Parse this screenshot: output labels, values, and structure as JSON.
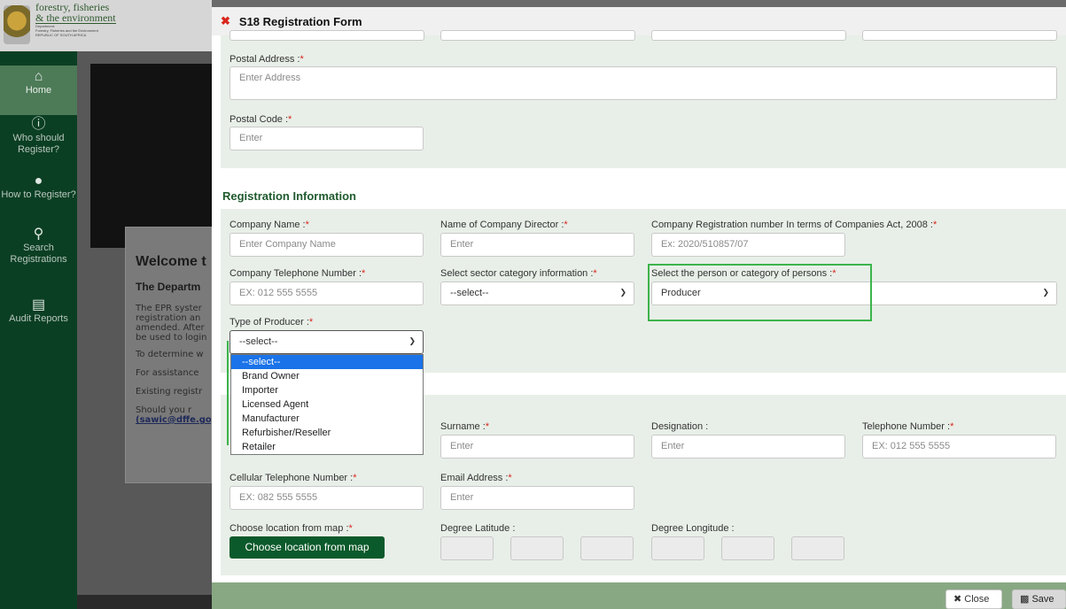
{
  "site": {
    "logo_line1": "forestry, fisheries",
    "logo_line2": "& the environment",
    "logo_small1": "Department:",
    "logo_small2": "Forestry, Fisheries and the Environment",
    "logo_small3": "REPUBLIC OF SOUTH AFRICA"
  },
  "nav": [
    {
      "label": "Home",
      "icon": "home-icon"
    },
    {
      "label": "Who should Register?",
      "icon": "question-icon"
    },
    {
      "label": "How to Register?",
      "icon": "info-icon"
    },
    {
      "label": "Search Registrations",
      "icon": "search-icon"
    },
    {
      "label": "Audit Reports",
      "icon": "report-icon"
    }
  ],
  "background": {
    "welcome": "Welcome t",
    "department": "The Departm",
    "para": [
      "The EPR syster",
      "registration an",
      "amended. After",
      "be used to login"
    ],
    "determine": "To determine w",
    "assistance": "For assistance",
    "existing": "Existing registr",
    "should": "Should you r",
    "email": "(sawic@dffe.go"
  },
  "modal": {
    "title": "S18 Registration Form",
    "postal_address_label": "Postal Address :",
    "postal_address_placeholder": "Enter Address",
    "postal_code_label": "Postal Code :",
    "postal_code_placeholder": "Enter",
    "registration_section": "Registration Information",
    "company_name_label": "Company Name :",
    "company_name_placeholder": "Enter Company Name",
    "director_label": "Name of Company Director :",
    "director_placeholder": "Enter",
    "reg_number_label": "Company Registration number In terms of Companies Act, 2008 :",
    "reg_number_placeholder": "Ex: 2020/510857/07",
    "company_tel_label": "Company Telephone Number :",
    "company_tel_placeholder": "EX: 012 555 5555",
    "sector_label": "Select sector category information :",
    "sector_value": "--select--",
    "person_cat_label": "Select the person or category of persons :",
    "person_cat_value": "Producer",
    "producer_type_label": "Type of Producer :",
    "producer_type_value": "--select--",
    "producer_options": [
      "--select--",
      "Brand Owner",
      "Importer",
      "Licensed Agent",
      "Manufacturer",
      "Refurbisher/Reseller",
      "Retailer"
    ],
    "surname_label": "Surname :",
    "surname_placeholder": "Enter",
    "designation_label": "Designation :",
    "designation_placeholder": "Enter",
    "telephone_label": "Telephone Number :",
    "telephone_placeholder": "EX: 012 555 5555",
    "cell_label": "Cellular Telephone Number :",
    "cell_placeholder": "EX: 082 555 5555",
    "email_label": "Email Address :",
    "email_placeholder": "Enter",
    "map_label": "Choose location from map :",
    "map_button": "Choose location from map",
    "lat_label": "Degree Latitude :",
    "lon_label": "Degree Longitude :",
    "close_button": "Close",
    "save_button": "Save",
    "required_mark": "*"
  }
}
